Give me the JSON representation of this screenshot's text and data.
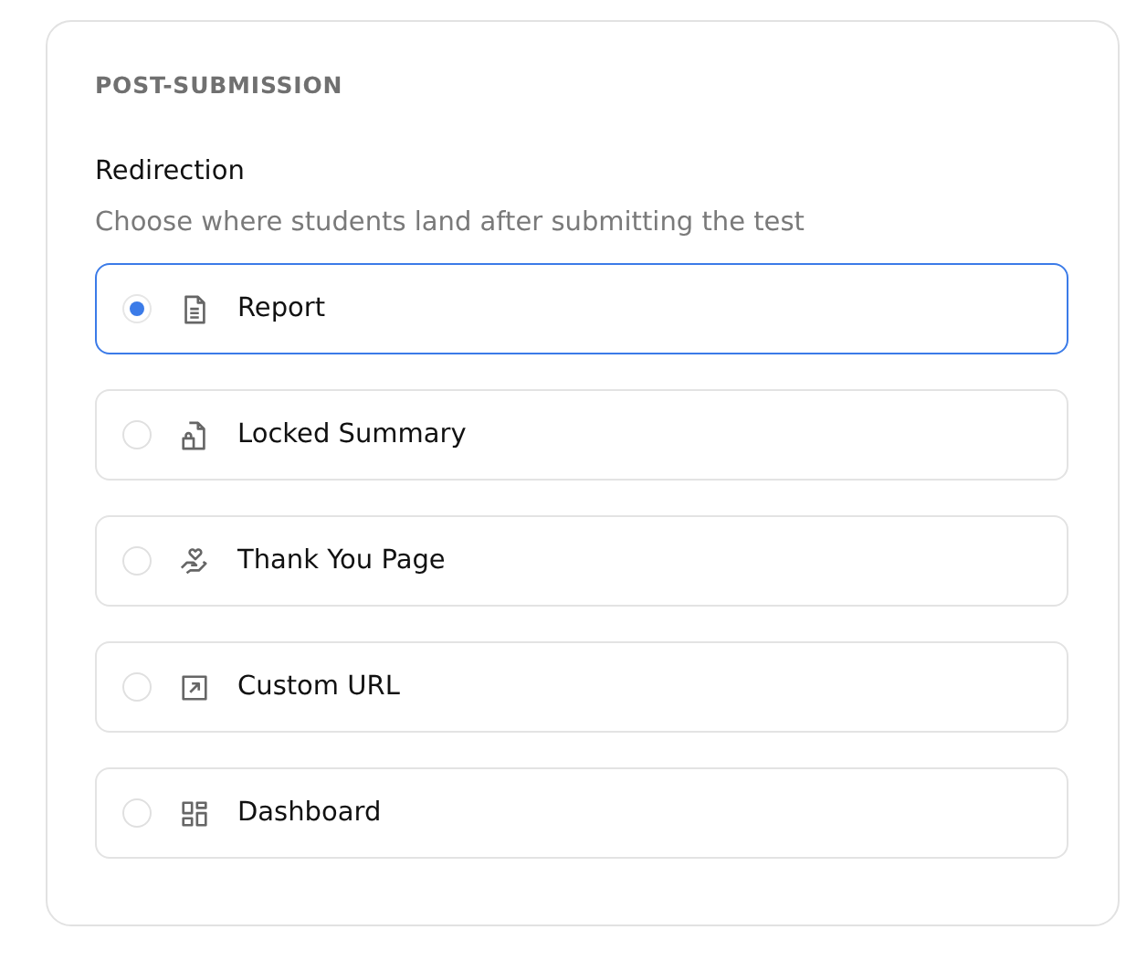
{
  "section_title": "POST-SUBMISSION",
  "field": {
    "label": "Redirection",
    "description": "Choose where students land after submitting the test"
  },
  "options": [
    {
      "label": "Report",
      "kind": "document",
      "selected": true
    },
    {
      "label": "Locked Summary",
      "kind": "locked",
      "selected": false
    },
    {
      "label": "Thank You Page",
      "kind": "hand",
      "selected": false
    },
    {
      "label": "Custom URL",
      "kind": "link",
      "selected": false
    },
    {
      "label": "Dashboard",
      "kind": "grid",
      "selected": false
    }
  ]
}
